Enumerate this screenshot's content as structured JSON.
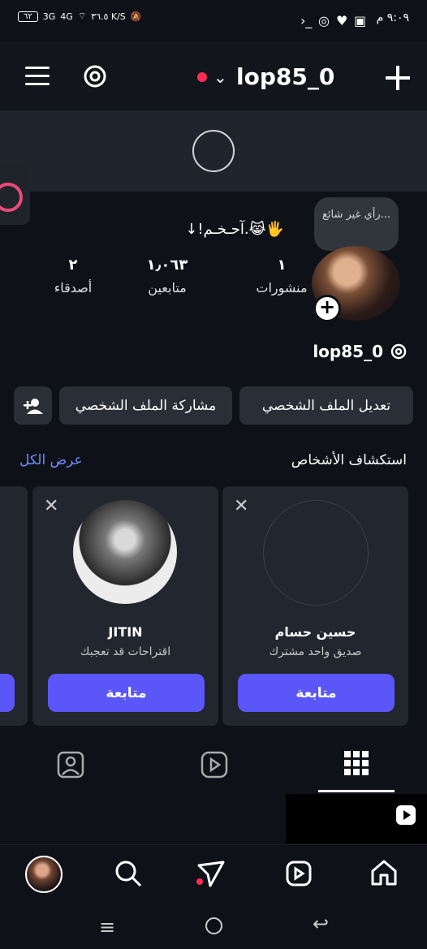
{
  "status": {
    "time": "٩:٠٩ م",
    "battery": "٦٢",
    "network_left": "3G",
    "network_right": "4G",
    "speed": "٣٦.٥ K/S"
  },
  "header": {
    "username": "lop85_0"
  },
  "profile": {
    "note": "رأي غير شائع...",
    "bio": "↓!آحـخـم.😹🖐",
    "stats": [
      {
        "label": "منشورات",
        "value": "١"
      },
      {
        "label": "متابعين",
        "value": "١٫٠٦٣"
      },
      {
        "label": "أصدقاء",
        "value": "٢"
      }
    ],
    "handle": "lop85_0"
  },
  "actions": {
    "edit_profile": "تعديل الملف الشخصي",
    "share_profile": "مشاركة الملف الشخصي"
  },
  "discover": {
    "title": "استكشاف الأشخاص",
    "see_all": "عرض الكل",
    "cards": [
      {
        "name": "حسين حسام",
        "subtitle": "صديق واحد مشترك",
        "button": "متابعة"
      },
      {
        "name": "JITIN",
        "subtitle": "اقتراحات قد تعجبك",
        "button": "متابعة"
      }
    ]
  },
  "icons": {
    "menu": "menu-icon",
    "threads": "threads-icon",
    "add": "plus-icon",
    "tag": "tagged-photos-icon",
    "reels": "reels-icon",
    "grid": "grid-icon",
    "home": "home-icon",
    "search": "search-icon",
    "send": "send-icon",
    "play": "play-icon"
  },
  "colors": {
    "background": "#0e1117",
    "button": "#5b56f8",
    "accent_link": "#6a8dff",
    "notification_dot": "#ff2d55"
  }
}
